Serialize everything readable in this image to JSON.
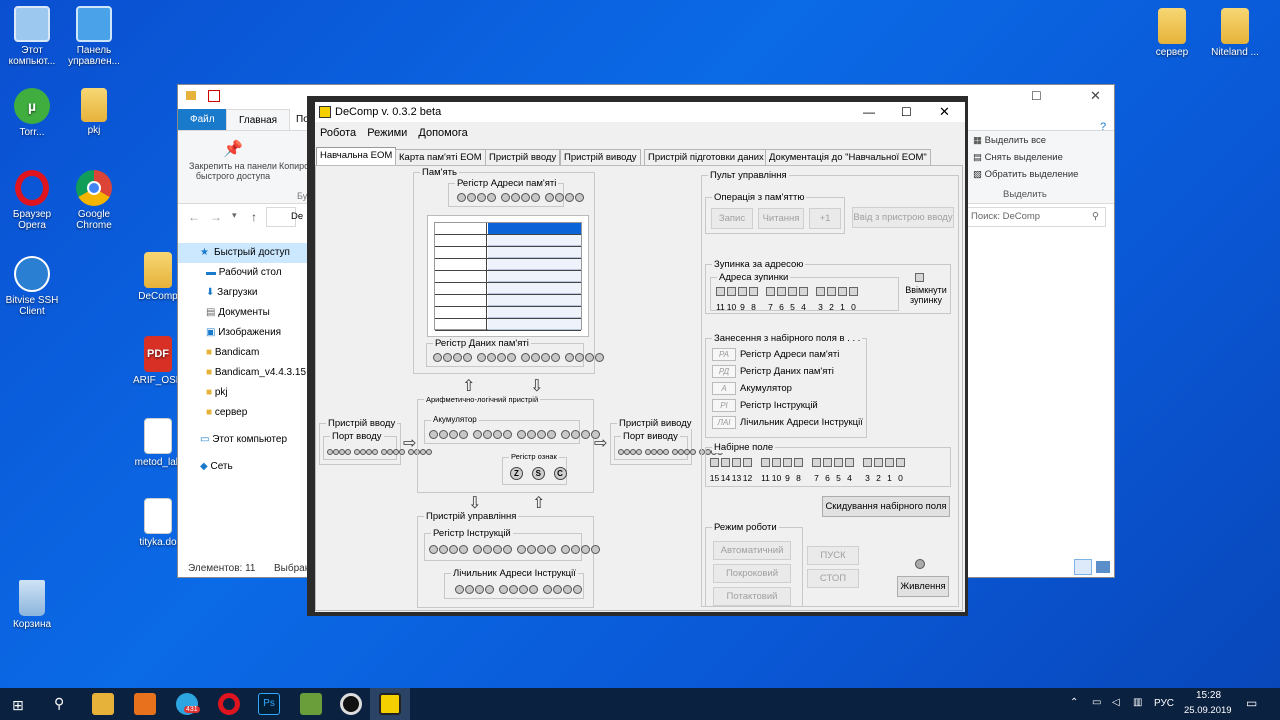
{
  "desktop_icons": [
    {
      "label": "Этот компьют...",
      "icon": "computer-icon"
    },
    {
      "label": "Панель управлен...",
      "icon": "control-panel-icon"
    },
    {
      "label": "Torr...",
      "icon": "utorrent-icon"
    },
    {
      "label": "pkj",
      "icon": "folder-icon"
    },
    {
      "label": "Браузер Opera",
      "icon": "opera-icon"
    },
    {
      "label": "Google Chrome",
      "icon": "chrome-icon"
    },
    {
      "label": "Bitvise SSH Client",
      "icon": "bitvise-icon"
    },
    {
      "label": "DeComp",
      "icon": "folder-icon"
    },
    {
      "label": "ARIF_OSN",
      "icon": "pdf-icon"
    },
    {
      "label": "metod_lab",
      "icon": "document-icon"
    },
    {
      "label": "tityka.do",
      "icon": "document-icon"
    },
    {
      "label": "Корзина",
      "icon": "recycle-bin-icon"
    },
    {
      "label": "сервер",
      "icon": "folder-icon"
    },
    {
      "label": "Niteland ...",
      "icon": "folder-icon"
    }
  ],
  "explorer": {
    "title": "DeComp",
    "ribbon_tabs": [
      "Файл",
      "Главная",
      "По"
    ],
    "pin_label": "Закрепить на панели быстрого доступа",
    "copy_label": "Копиро",
    "group_label": "Бу",
    "select_all": "Выделить все",
    "deselect": "Снять выделение",
    "invert": "Обратить выделение",
    "select_group": "Выделить",
    "search_placeholder": "Поиск: DeComp",
    "address": "De",
    "nav": [
      "Быстрый доступ",
      "Рабочий стол",
      "Загрузки",
      "Документы",
      "Изображения",
      "Bandicam",
      "Bandicam_v4.4.3.15",
      "pkj",
      "сервер",
      "Этот компьютер",
      "Сеть"
    ],
    "status_items": "Элементов: 11",
    "status_selected": "Выбран"
  },
  "decomp": {
    "title": "DeComp v. 0.3.2 beta",
    "menu": [
      "Робота",
      "Режими",
      "Допомога"
    ],
    "tabs": [
      "Навчальна ЕОМ",
      "Карта пам'яті ЕОМ",
      "Пристрій вводу",
      "Пристрій виводу",
      "Пристрій підготовки даних",
      "Документація до \"Навчальної ЕОМ\""
    ],
    "memory": {
      "group": "Пам'ять",
      "addr_reg": "Регістр Адреси пам'яті",
      "data_reg": "Регістр Даних пам'яті"
    },
    "input": {
      "group": "Пристрій вводу",
      "port": "Порт вводу"
    },
    "output": {
      "group": "Пристрій виводу",
      "port": "Порт виводу"
    },
    "alu": {
      "group": "Арифметично-логічний пристрій",
      "acc": "Акумулятор",
      "flags": "Регістр ознак",
      "flag_letters": [
        "Z",
        "S",
        "C"
      ]
    },
    "control": {
      "group": "Пристрій управління",
      "ir": "Регістр Інструкцій",
      "pc": "Лічильник Адреси Інструкції"
    },
    "panel": {
      "group": "Пульт управління",
      "mem_op": "Операція з пам'яттю",
      "write": "Запис",
      "read": "Читання",
      "plus1": "+1",
      "from_input": "Ввід з пристрою вводу",
      "stop_addr": "Зупинка за адресою",
      "stop_addr_label": "Адреса зупинки",
      "stop_bits": [
        "11",
        "10",
        "9",
        "8",
        "7",
        "6",
        "5",
        "4",
        "3",
        "2",
        "1",
        "0"
      ],
      "enable_stop": "Ввімкнути зупинку",
      "load_group": "Занесення з набірного поля в . . .",
      "load_items": [
        {
          "tag": "РА",
          "label": "Регістр Адреси пам'яті"
        },
        {
          "tag": "РД",
          "label": "Регістр Даних пам'яті"
        },
        {
          "tag": "А",
          "label": "Акумулятор"
        },
        {
          "tag": "РІ",
          "label": "Регістр Інструкцій"
        },
        {
          "tag": "ЛАІ",
          "label": "Лічильник Адреси Інструкції"
        }
      ],
      "switch_group": "Набірне поле",
      "switch_bits": [
        "15",
        "14",
        "13",
        "12",
        "11",
        "10",
        "9",
        "8",
        "7",
        "6",
        "5",
        "4",
        "3",
        "2",
        "1",
        "0"
      ],
      "reset": "Скидування набірного поля",
      "mode_group": "Режим роботи",
      "auto": "Автоматичний",
      "step": "Покроковий",
      "tact": "Потактовий",
      "start": "ПУСК",
      "stop": "СТОП",
      "power": "Живлення"
    }
  },
  "taskbar": {
    "lang": "РУС",
    "time": "15:28",
    "date": "25.09.2019",
    "telegram_badge": "431"
  }
}
